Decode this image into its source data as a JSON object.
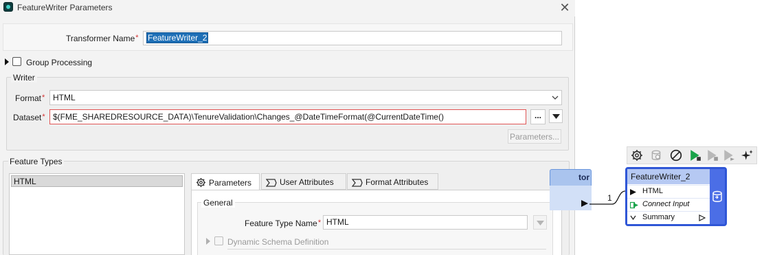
{
  "dialog": {
    "title": "FeatureWriter Parameters",
    "close_glyph": "✕",
    "transformer_name_label": "Transformer Name",
    "transformer_name_value": "FeatureWriter_2",
    "required_mark": "*",
    "group_processing_label": "Group Processing",
    "writer": {
      "group_label": "Writer",
      "format_label": "Format",
      "format_value": "HTML",
      "dataset_label": "Dataset",
      "dataset_value": "$(FME_SHAREDRESOURCE_DATA)\\TenureValidation\\Changes_@DateTimeFormat(@CurrentDateTime()",
      "browse_label": "...",
      "parameters_button": "Parameters..."
    },
    "feature_types": {
      "group_label": "Feature Types",
      "items": [
        "HTML"
      ],
      "tabs": [
        {
          "label": "Parameters",
          "icon": "gear-icon",
          "active": true
        },
        {
          "label": "User Attributes",
          "icon": "sigma-icon",
          "active": false
        },
        {
          "label": "Format Attributes",
          "icon": "sigma-icon",
          "active": false
        }
      ],
      "general_label": "General",
      "feature_type_name_label": "Feature Type Name",
      "feature_type_name_value": "HTML",
      "dynamic_schema_label": "Dynamic Schema Definition"
    }
  },
  "workspace": {
    "toolbar_icons": [
      "gear-icon",
      "inspect-icon",
      "disable-icon",
      "run-to-icon",
      "run-from-icon",
      "step-icon",
      "sparkle-icon"
    ],
    "previous_node_title": "tor",
    "connection_label": "1",
    "node": {
      "title": "FeatureWriter_2",
      "ports": [
        {
          "label": "HTML",
          "italic": false
        },
        {
          "label": "Connect Input",
          "italic": true
        },
        {
          "label": "Summary",
          "italic": false
        }
      ]
    },
    "colors": {
      "node_border": "#2f56d6",
      "node_header": "#b6c9f3",
      "run_green": "#1aa34a"
    }
  }
}
